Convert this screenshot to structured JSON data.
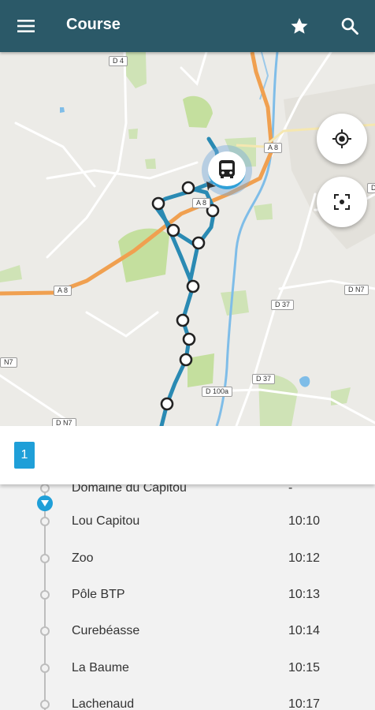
{
  "appbar": {
    "title": "Course",
    "menu_icon": "menu-icon",
    "favorite_icon": "star-icon",
    "search_icon": "search-icon",
    "color": "#2b5968"
  },
  "map": {
    "road_labels": [
      "D 4",
      "A 8",
      "A 8",
      "A 8",
      "D 37",
      "D N7",
      "N7",
      "D 37",
      "D 100a",
      "D N7",
      "D"
    ],
    "route_color": "#2a8ab3",
    "highway_color": "#f0a050",
    "river_color": "#6ab0e4",
    "buttons": {
      "locate_icon": "my-location-icon",
      "fit_icon": "fit-screen-icon"
    },
    "vehicle_icon": "bus-icon"
  },
  "line": {
    "number": "1",
    "color": "#1f9fd8"
  },
  "stops": [
    {
      "name": "Domaine du Capitou",
      "time": "-"
    },
    {
      "name": "Lou Capitou",
      "time": "10:10"
    },
    {
      "name": "Zoo",
      "time": "10:12"
    },
    {
      "name": "Pôle BTP",
      "time": "10:13"
    },
    {
      "name": "Curebéasse",
      "time": "10:14"
    },
    {
      "name": "La Baume",
      "time": "10:15"
    },
    {
      "name": "Lachenaud",
      "time": "10:17"
    }
  ]
}
